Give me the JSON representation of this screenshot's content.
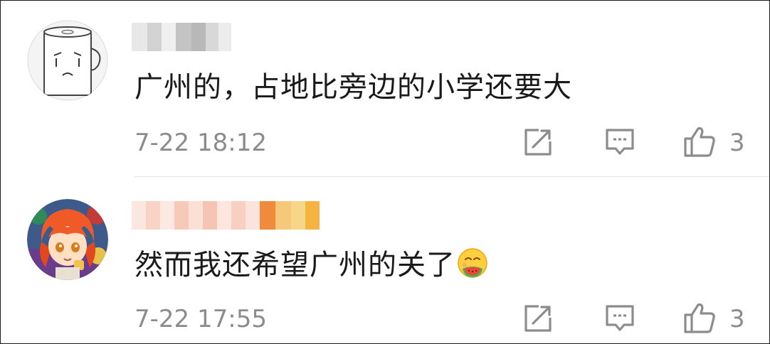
{
  "comments": [
    {
      "avatar": "tissue-roll-avatar",
      "username": "",
      "text": "广州的，占地比旁边的小学还要大",
      "time": "7-22 18:12",
      "likes": "3"
    },
    {
      "avatar": "anime-character-avatar",
      "username": "",
      "text": "然而我还希望广州的关了",
      "emoji": "smiling-face-eating-watermelon-emoji",
      "time": "7-22 17:55",
      "likes": "3"
    }
  ],
  "colors": {
    "text": "#1a1a1a",
    "meta": "#8c8c8c",
    "divider": "#e3e3e3",
    "highlight_badge": "#f5b342"
  }
}
